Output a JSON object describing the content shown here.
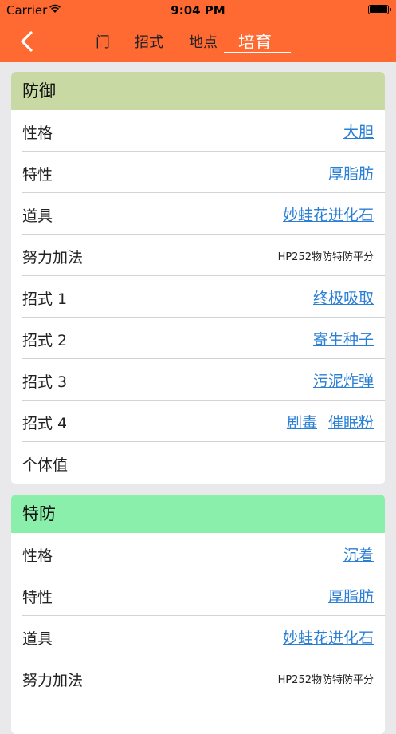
{
  "status_bar": {
    "carrier": "Carrier",
    "time": "9:04 PM"
  },
  "nav": {
    "tabs": [
      {
        "label": "门",
        "partial": true
      },
      {
        "label": "招式"
      },
      {
        "label": "地点"
      },
      {
        "label": "培育",
        "active": true
      }
    ],
    "accent": "#ff6a33"
  },
  "cards": [
    {
      "title": "防御",
      "header_color": "#c8d9a3",
      "rows": [
        {
          "label": "性格",
          "links": [
            "大胆"
          ]
        },
        {
          "label": "特性",
          "links": [
            "厚脂肪"
          ]
        },
        {
          "label": "道具",
          "links": [
            "妙蛙花进化石"
          ]
        },
        {
          "label": "努力加法",
          "text": "HP252物防特防平分"
        },
        {
          "label": "招式 1",
          "links": [
            "终极吸取"
          ]
        },
        {
          "label": "招式 2",
          "links": [
            "寄生种子"
          ]
        },
        {
          "label": "招式 3",
          "links": [
            "污泥炸弹"
          ]
        },
        {
          "label": "招式 4",
          "links": [
            "剧毒",
            "催眠粉"
          ]
        },
        {
          "label": "个体值"
        }
      ]
    },
    {
      "title": "特防",
      "header_color": "#8aefaa",
      "rows": [
        {
          "label": "性格",
          "links": [
            "沉着"
          ]
        },
        {
          "label": "特性",
          "links": [
            "厚脂肪"
          ]
        },
        {
          "label": "道具",
          "links": [
            "妙蛙花进化石"
          ]
        },
        {
          "label": "努力加法",
          "text": "HP252物防特防平分"
        }
      ]
    }
  ]
}
